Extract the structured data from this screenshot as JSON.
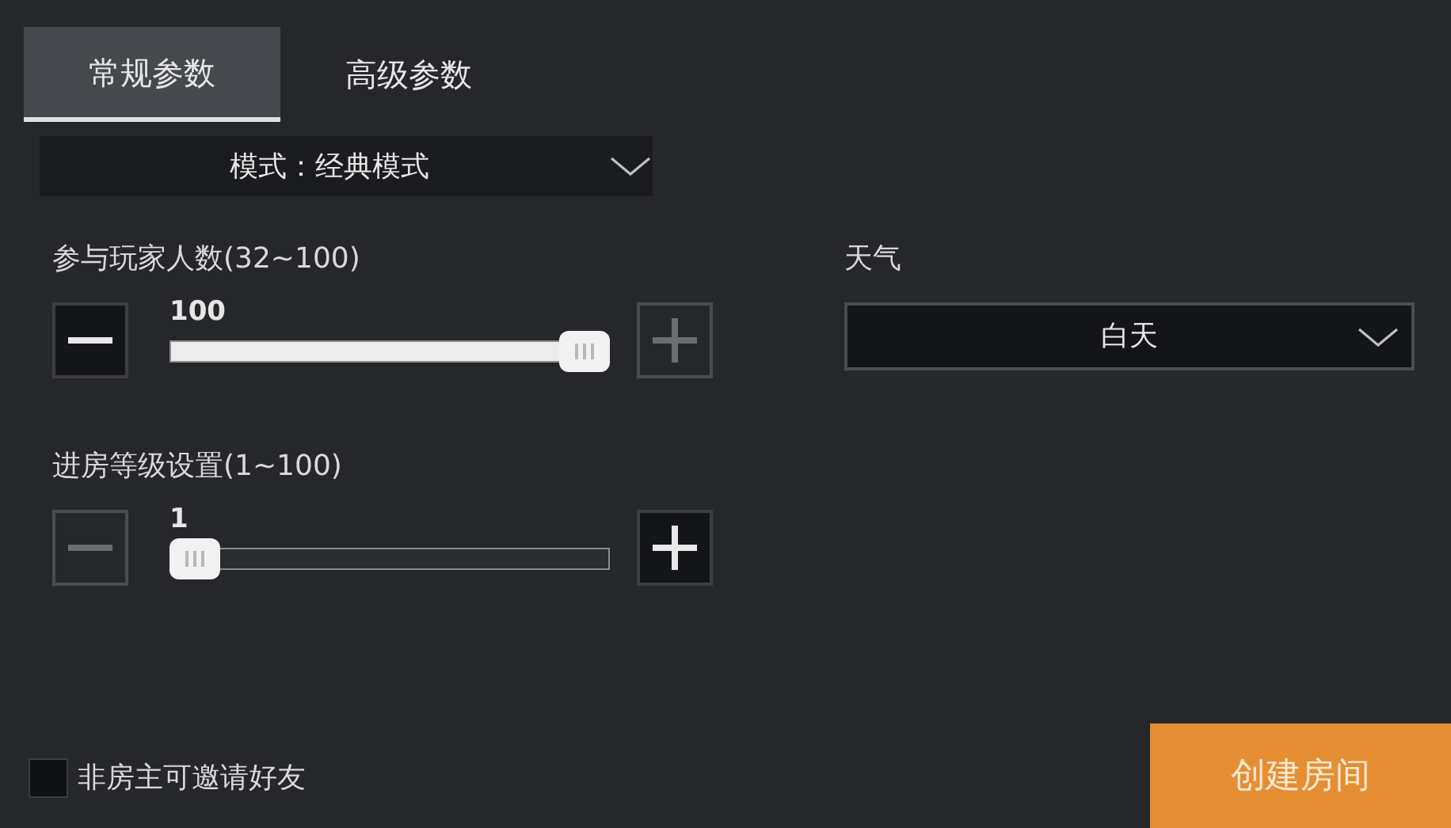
{
  "tabs": [
    {
      "label": "常规参数",
      "selected": true
    },
    {
      "label": "高级参数",
      "selected": false
    }
  ],
  "mode": {
    "value": "模式：经典模式"
  },
  "sliders": [
    {
      "label": "参与玩家人数(32~100)",
      "reading": "100",
      "minus_disabled": false,
      "plus_disabled": true
    },
    {
      "label": "进房等级设置(1~100)",
      "reading": "1",
      "minus_disabled": true,
      "plus_disabled": false
    }
  ],
  "weather": {
    "label": "天气",
    "value": "白天"
  },
  "invite_checkbox": {
    "label": "非房主可邀请好友",
    "checked": false
  },
  "create_button": {
    "label": "创建房间"
  }
}
